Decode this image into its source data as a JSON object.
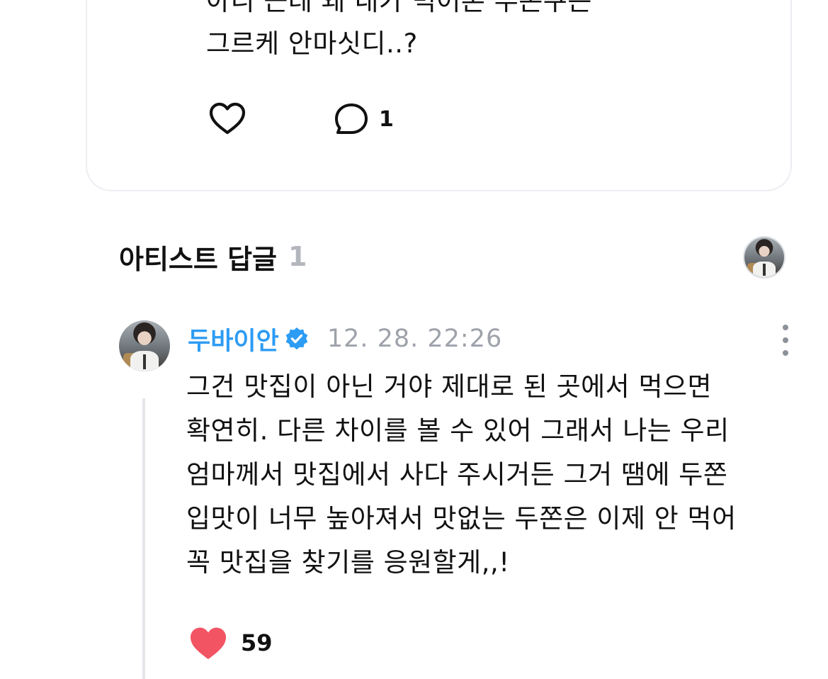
{
  "post": {
    "text_lines": [
      "아니 근데 왜 내가 먹어본 두쫀쿠는",
      "그르케 안마싯디..?"
    ],
    "comment_count": "1"
  },
  "replies_section": {
    "title": "아티스트 답글",
    "count": "1"
  },
  "reply": {
    "author": "두바이안",
    "timestamp": "12. 28. 22:26",
    "body_lines": [
      "그건 맛집이 아닌 거야 제대로 된 곳에서 먹으면",
      "확연히. 다른 차이를 볼 수 있어 그래서 나는 우리",
      "엄마께서 맛집에서 사다 주시거든 그거 땜에 두쫀",
      "입맛이 너무 높아져서 맛없는 두쫀은 이제 안 먹어",
      "꼭 맛집을 찾기를 응원할게,,!"
    ],
    "like_count": "59"
  },
  "colors": {
    "author_blue": "#2d9cf4",
    "verified_blue": "#2d9cf4",
    "like_red": "#f25463",
    "muted_gray": "#9ea2aa",
    "count_gray": "#b3b6bd"
  },
  "icons": {
    "post_like": "heart-outline-icon",
    "post_comment": "speech-bubble-icon",
    "verified": "verified-badge-icon",
    "more": "more-vertical-icon",
    "reply_like": "heart-filled-icon"
  }
}
